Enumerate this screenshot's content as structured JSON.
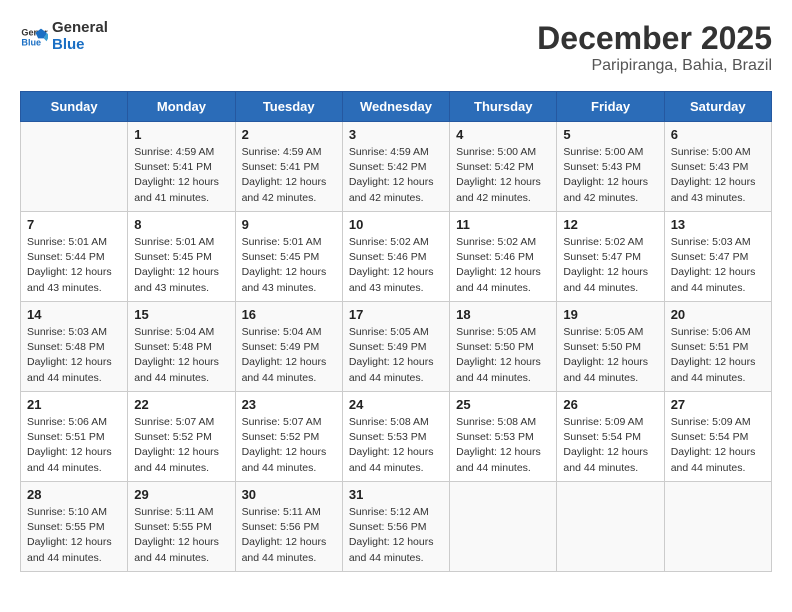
{
  "header": {
    "logo_line1": "General",
    "logo_line2": "Blue",
    "title": "December 2025",
    "subtitle": "Paripiranga, Bahia, Brazil"
  },
  "weekdays": [
    "Sunday",
    "Monday",
    "Tuesday",
    "Wednesday",
    "Thursday",
    "Friday",
    "Saturday"
  ],
  "weeks": [
    [
      {
        "day": "",
        "sunrise": "",
        "sunset": "",
        "daylight": ""
      },
      {
        "day": "1",
        "sunrise": "Sunrise: 4:59 AM",
        "sunset": "Sunset: 5:41 PM",
        "daylight": "Daylight: 12 hours and 41 minutes."
      },
      {
        "day": "2",
        "sunrise": "Sunrise: 4:59 AM",
        "sunset": "Sunset: 5:41 PM",
        "daylight": "Daylight: 12 hours and 42 minutes."
      },
      {
        "day": "3",
        "sunrise": "Sunrise: 4:59 AM",
        "sunset": "Sunset: 5:42 PM",
        "daylight": "Daylight: 12 hours and 42 minutes."
      },
      {
        "day": "4",
        "sunrise": "Sunrise: 5:00 AM",
        "sunset": "Sunset: 5:42 PM",
        "daylight": "Daylight: 12 hours and 42 minutes."
      },
      {
        "day": "5",
        "sunrise": "Sunrise: 5:00 AM",
        "sunset": "Sunset: 5:43 PM",
        "daylight": "Daylight: 12 hours and 42 minutes."
      },
      {
        "day": "6",
        "sunrise": "Sunrise: 5:00 AM",
        "sunset": "Sunset: 5:43 PM",
        "daylight": "Daylight: 12 hours and 43 minutes."
      }
    ],
    [
      {
        "day": "7",
        "sunrise": "Sunrise: 5:01 AM",
        "sunset": "Sunset: 5:44 PM",
        "daylight": "Daylight: 12 hours and 43 minutes."
      },
      {
        "day": "8",
        "sunrise": "Sunrise: 5:01 AM",
        "sunset": "Sunset: 5:45 PM",
        "daylight": "Daylight: 12 hours and 43 minutes."
      },
      {
        "day": "9",
        "sunrise": "Sunrise: 5:01 AM",
        "sunset": "Sunset: 5:45 PM",
        "daylight": "Daylight: 12 hours and 43 minutes."
      },
      {
        "day": "10",
        "sunrise": "Sunrise: 5:02 AM",
        "sunset": "Sunset: 5:46 PM",
        "daylight": "Daylight: 12 hours and 43 minutes."
      },
      {
        "day": "11",
        "sunrise": "Sunrise: 5:02 AM",
        "sunset": "Sunset: 5:46 PM",
        "daylight": "Daylight: 12 hours and 44 minutes."
      },
      {
        "day": "12",
        "sunrise": "Sunrise: 5:02 AM",
        "sunset": "Sunset: 5:47 PM",
        "daylight": "Daylight: 12 hours and 44 minutes."
      },
      {
        "day": "13",
        "sunrise": "Sunrise: 5:03 AM",
        "sunset": "Sunset: 5:47 PM",
        "daylight": "Daylight: 12 hours and 44 minutes."
      }
    ],
    [
      {
        "day": "14",
        "sunrise": "Sunrise: 5:03 AM",
        "sunset": "Sunset: 5:48 PM",
        "daylight": "Daylight: 12 hours and 44 minutes."
      },
      {
        "day": "15",
        "sunrise": "Sunrise: 5:04 AM",
        "sunset": "Sunset: 5:48 PM",
        "daylight": "Daylight: 12 hours and 44 minutes."
      },
      {
        "day": "16",
        "sunrise": "Sunrise: 5:04 AM",
        "sunset": "Sunset: 5:49 PM",
        "daylight": "Daylight: 12 hours and 44 minutes."
      },
      {
        "day": "17",
        "sunrise": "Sunrise: 5:05 AM",
        "sunset": "Sunset: 5:49 PM",
        "daylight": "Daylight: 12 hours and 44 minutes."
      },
      {
        "day": "18",
        "sunrise": "Sunrise: 5:05 AM",
        "sunset": "Sunset: 5:50 PM",
        "daylight": "Daylight: 12 hours and 44 minutes."
      },
      {
        "day": "19",
        "sunrise": "Sunrise: 5:05 AM",
        "sunset": "Sunset: 5:50 PM",
        "daylight": "Daylight: 12 hours and 44 minutes."
      },
      {
        "day": "20",
        "sunrise": "Sunrise: 5:06 AM",
        "sunset": "Sunset: 5:51 PM",
        "daylight": "Daylight: 12 hours and 44 minutes."
      }
    ],
    [
      {
        "day": "21",
        "sunrise": "Sunrise: 5:06 AM",
        "sunset": "Sunset: 5:51 PM",
        "daylight": "Daylight: 12 hours and 44 minutes."
      },
      {
        "day": "22",
        "sunrise": "Sunrise: 5:07 AM",
        "sunset": "Sunset: 5:52 PM",
        "daylight": "Daylight: 12 hours and 44 minutes."
      },
      {
        "day": "23",
        "sunrise": "Sunrise: 5:07 AM",
        "sunset": "Sunset: 5:52 PM",
        "daylight": "Daylight: 12 hours and 44 minutes."
      },
      {
        "day": "24",
        "sunrise": "Sunrise: 5:08 AM",
        "sunset": "Sunset: 5:53 PM",
        "daylight": "Daylight: 12 hours and 44 minutes."
      },
      {
        "day": "25",
        "sunrise": "Sunrise: 5:08 AM",
        "sunset": "Sunset: 5:53 PM",
        "daylight": "Daylight: 12 hours and 44 minutes."
      },
      {
        "day": "26",
        "sunrise": "Sunrise: 5:09 AM",
        "sunset": "Sunset: 5:54 PM",
        "daylight": "Daylight: 12 hours and 44 minutes."
      },
      {
        "day": "27",
        "sunrise": "Sunrise: 5:09 AM",
        "sunset": "Sunset: 5:54 PM",
        "daylight": "Daylight: 12 hours and 44 minutes."
      }
    ],
    [
      {
        "day": "28",
        "sunrise": "Sunrise: 5:10 AM",
        "sunset": "Sunset: 5:55 PM",
        "daylight": "Daylight: 12 hours and 44 minutes."
      },
      {
        "day": "29",
        "sunrise": "Sunrise: 5:11 AM",
        "sunset": "Sunset: 5:55 PM",
        "daylight": "Daylight: 12 hours and 44 minutes."
      },
      {
        "day": "30",
        "sunrise": "Sunrise: 5:11 AM",
        "sunset": "Sunset: 5:56 PM",
        "daylight": "Daylight: 12 hours and 44 minutes."
      },
      {
        "day": "31",
        "sunrise": "Sunrise: 5:12 AM",
        "sunset": "Sunset: 5:56 PM",
        "daylight": "Daylight: 12 hours and 44 minutes."
      },
      {
        "day": "",
        "sunrise": "",
        "sunset": "",
        "daylight": ""
      },
      {
        "day": "",
        "sunrise": "",
        "sunset": "",
        "daylight": ""
      },
      {
        "day": "",
        "sunrise": "",
        "sunset": "",
        "daylight": ""
      }
    ]
  ]
}
